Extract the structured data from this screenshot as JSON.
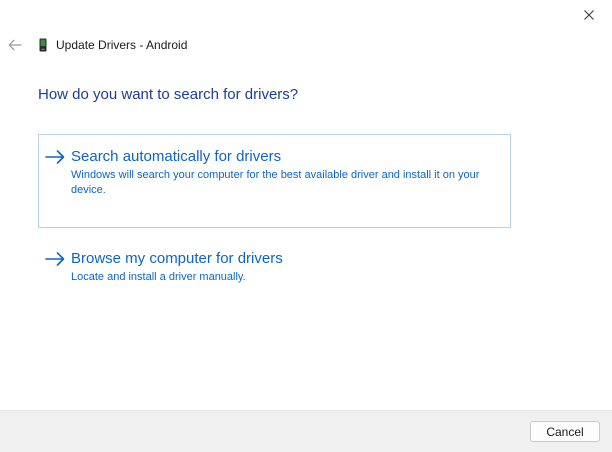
{
  "window": {
    "title": "Update Drivers - Android"
  },
  "prompt": {
    "question": "How do you want to search for drivers?"
  },
  "options": [
    {
      "title": "Search automatically for drivers",
      "description": "Windows will search your computer for the best available driver and install it on your device."
    },
    {
      "title": "Browse my computer for drivers",
      "description": "Locate and install a driver manually."
    }
  ],
  "footer": {
    "cancel_label": "Cancel"
  },
  "icons": {
    "close": "close-icon",
    "back": "back-arrow-icon",
    "device": "phone-icon",
    "option_arrow": "arrow-right-icon"
  },
  "colors": {
    "accent": "#0e65c0",
    "question": "#1c3d9a",
    "selected_border": "#b6d3e8",
    "footer_bg": "#f0f0f0"
  }
}
